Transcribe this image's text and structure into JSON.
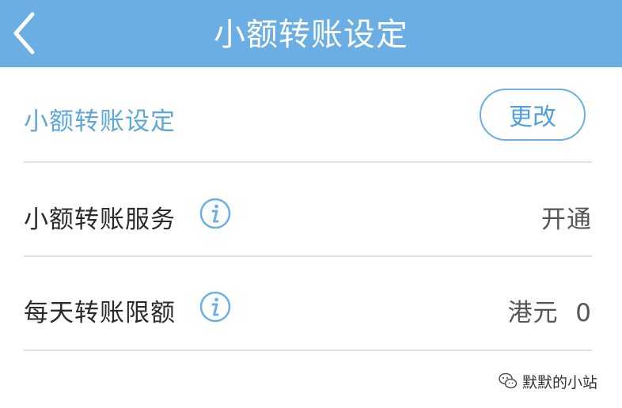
{
  "header": {
    "title": "小额转账设定",
    "back_icon": "chevron-left-icon",
    "background_color": "#6aaee3"
  },
  "section": {
    "title": "小额转账设定",
    "change_button_label": "更改",
    "accent_color": "#5ea7d9"
  },
  "rows": [
    {
      "label": "小额转账服务",
      "info_icon": "info-icon",
      "value": "开通"
    },
    {
      "label": "每天转账限额",
      "info_icon": "info-icon",
      "value": "港元  0"
    }
  ],
  "watermark": {
    "text": "默默的小站",
    "icon": "wechat-logo-icon"
  }
}
